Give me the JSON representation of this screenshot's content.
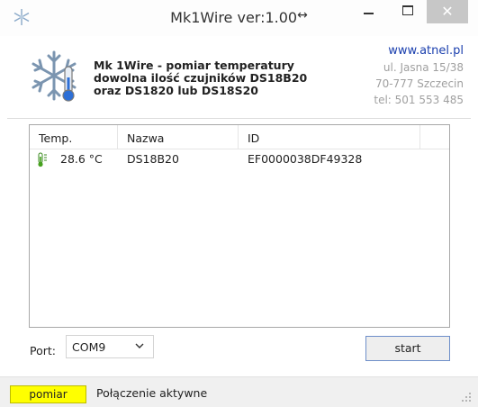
{
  "window": {
    "title": "Mk1Wire  ver:1.00",
    "title_arrow": "↔",
    "close_glyph": "✕"
  },
  "header": {
    "desc_line1": "Mk 1Wire - pomiar temperatury",
    "desc_line2": "dowolna ilość czujników DS18B20",
    "desc_line3": "oraz DS1820 lub DS18S20",
    "website": "www.atnel.pl",
    "address_line1": "ul. Jasna 15/38",
    "address_line2": "70-777 Szczecin",
    "phone": "tel: 501 553 485"
  },
  "table": {
    "columns": [
      "Temp.",
      "Nazwa",
      "ID"
    ],
    "rows": [
      {
        "temp": "28.6 °C",
        "name": "DS18B20",
        "id": "EF0000038DF49328"
      }
    ]
  },
  "controls": {
    "port_label": "Port:",
    "port_value": "COM9",
    "start_label": "start"
  },
  "status": {
    "badge": "pomiar",
    "text": "Połączenie aktywne"
  },
  "colors": {
    "status_badge": "#ffff00",
    "website_link": "#1a3fae",
    "close_button": "#c7c7c7"
  }
}
